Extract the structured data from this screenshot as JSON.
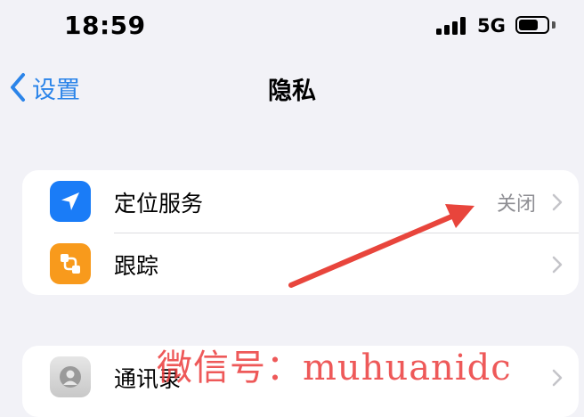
{
  "status_bar": {
    "time": "18:59",
    "network": "5G",
    "signal_bars": 4,
    "battery_level": 0.7
  },
  "nav": {
    "back_label": "设置",
    "title": "隐私"
  },
  "groups": [
    {
      "rows": [
        {
          "label": "定位服务",
          "value": "关闭",
          "icon": "location-arrow-icon",
          "icon_color": "#1a7cf7"
        },
        {
          "label": "跟踪",
          "value": "",
          "icon": "tracking-icon",
          "icon_color": "#f89a1c"
        }
      ]
    },
    {
      "rows": [
        {
          "label": "通讯录",
          "value": "",
          "icon": "contacts-icon",
          "icon_color": "#d4d4d4"
        }
      ]
    }
  ],
  "annotation": {
    "color": "#e8453c"
  },
  "watermark": "微信号：muhuanidc"
}
